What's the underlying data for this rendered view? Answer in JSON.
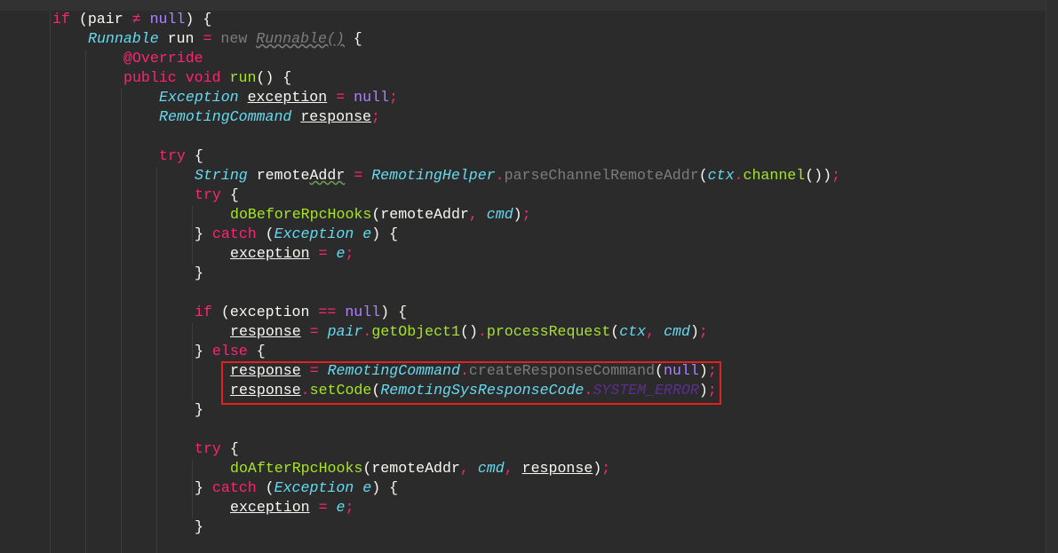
{
  "editor": {
    "language": "Java",
    "theme_colors": {
      "background": "#2b2b2b",
      "keyword": "#f92672",
      "type": "#66d9ef",
      "function": "#a6e22e",
      "null_literal": "#ae81ff",
      "plain": "#f8f8f2",
      "dim": "#7c7c7c",
      "constant": "#5e2d91",
      "highlight_box": "#e2201d"
    },
    "lines": [
      {
        "tokens": [
          {
            "t": "if",
            "c": "kw"
          },
          {
            "t": " (",
            "c": "plain"
          },
          {
            "t": "pair",
            "c": "var"
          },
          {
            "t": " ≠ ",
            "c": "op"
          },
          {
            "t": "null",
            "c": "null"
          },
          {
            "t": ") {",
            "c": "plain"
          }
        ]
      },
      {
        "tokens": [
          {
            "t": "Runnable",
            "c": "type"
          },
          {
            "t": " run ",
            "c": "var"
          },
          {
            "t": "=",
            "c": "op"
          },
          {
            "t": " ",
            "c": "plain"
          },
          {
            "t": "new",
            "c": "new"
          },
          {
            "t": " ",
            "c": "plain"
          },
          {
            "t": "Runnable()",
            "c": "anon"
          },
          {
            "t": " {",
            "c": "plain"
          }
        ]
      },
      {
        "tokens": [
          {
            "t": "@Override",
            "c": "ann"
          }
        ]
      },
      {
        "tokens": [
          {
            "t": "public",
            "c": "kw"
          },
          {
            "t": " ",
            "c": "plain"
          },
          {
            "t": "void",
            "c": "kw"
          },
          {
            "t": " ",
            "c": "plain"
          },
          {
            "t": "run",
            "c": "fn"
          },
          {
            "t": "() {",
            "c": "plain"
          }
        ]
      },
      {
        "tokens": [
          {
            "t": "Exception",
            "c": "type"
          },
          {
            "t": " ",
            "c": "plain"
          },
          {
            "t": "exception",
            "c": "uvar"
          },
          {
            "t": " ",
            "c": "plain"
          },
          {
            "t": "=",
            "c": "op"
          },
          {
            "t": " ",
            "c": "plain"
          },
          {
            "t": "null",
            "c": "null"
          },
          {
            "t": ";",
            "c": "punct"
          }
        ]
      },
      {
        "tokens": [
          {
            "t": "RemotingCommand",
            "c": "type"
          },
          {
            "t": " ",
            "c": "plain"
          },
          {
            "t": "response",
            "c": "uvar"
          },
          {
            "t": ";",
            "c": "punct"
          }
        ]
      },
      {
        "tokens": []
      },
      {
        "tokens": [
          {
            "t": "try",
            "c": "kw"
          },
          {
            "t": " {",
            "c": "plain"
          }
        ]
      },
      {
        "tokens": [
          {
            "t": "String",
            "c": "type"
          },
          {
            "t": " remote",
            "c": "var"
          },
          {
            "t": "Addr",
            "c": "squig"
          },
          {
            "t": " ",
            "c": "plain"
          },
          {
            "t": "=",
            "c": "op"
          },
          {
            "t": " ",
            "c": "plain"
          },
          {
            "t": "RemotingHelper",
            "c": "type"
          },
          {
            "t": ".",
            "c": "punct"
          },
          {
            "t": "parseChannelRemoteAddr",
            "c": "fndim"
          },
          {
            "t": "(",
            "c": "plain"
          },
          {
            "t": "ctx",
            "c": "param"
          },
          {
            "t": ".",
            "c": "punct"
          },
          {
            "t": "channel",
            "c": "fn"
          },
          {
            "t": "())",
            "c": "plain"
          },
          {
            "t": ";",
            "c": "punct"
          }
        ]
      },
      {
        "tokens": [
          {
            "t": "try",
            "c": "kw"
          },
          {
            "t": " {",
            "c": "plain"
          }
        ]
      },
      {
        "tokens": [
          {
            "t": "doBeforeRpcHooks",
            "c": "fn"
          },
          {
            "t": "(remoteAddr",
            "c": "plain"
          },
          {
            "t": ", ",
            "c": "punct"
          },
          {
            "t": "cmd",
            "c": "param"
          },
          {
            "t": ")",
            "c": "plain"
          },
          {
            "t": ";",
            "c": "punct"
          }
        ]
      },
      {
        "tokens": [
          {
            "t": "} ",
            "c": "plain"
          },
          {
            "t": "catch",
            "c": "kw"
          },
          {
            "t": " (",
            "c": "plain"
          },
          {
            "t": "Exception",
            "c": "type"
          },
          {
            "t": " ",
            "c": "plain"
          },
          {
            "t": "e",
            "c": "param"
          },
          {
            "t": ") {",
            "c": "plain"
          }
        ]
      },
      {
        "tokens": [
          {
            "t": "exception",
            "c": "uvar"
          },
          {
            "t": " ",
            "c": "plain"
          },
          {
            "t": "=",
            "c": "op"
          },
          {
            "t": " ",
            "c": "plain"
          },
          {
            "t": "e",
            "c": "param"
          },
          {
            "t": ";",
            "c": "punct"
          }
        ]
      },
      {
        "tokens": [
          {
            "t": "}",
            "c": "plain"
          }
        ]
      },
      {
        "tokens": []
      },
      {
        "tokens": [
          {
            "t": "if",
            "c": "kw"
          },
          {
            "t": " (",
            "c": "plain"
          },
          {
            "t": "exception",
            "c": "var"
          },
          {
            "t": " == ",
            "c": "op"
          },
          {
            "t": "null",
            "c": "null"
          },
          {
            "t": ") {",
            "c": "plain"
          }
        ]
      },
      {
        "tokens": [
          {
            "t": "response",
            "c": "uvar"
          },
          {
            "t": " ",
            "c": "plain"
          },
          {
            "t": "=",
            "c": "op"
          },
          {
            "t": " ",
            "c": "plain"
          },
          {
            "t": "pair",
            "c": "param"
          },
          {
            "t": ".",
            "c": "punct"
          },
          {
            "t": "getObject1",
            "c": "fn"
          },
          {
            "t": "()",
            "c": "plain"
          },
          {
            "t": ".",
            "c": "punct"
          },
          {
            "t": "processRequest",
            "c": "fn"
          },
          {
            "t": "(",
            "c": "plain"
          },
          {
            "t": "ctx",
            "c": "param"
          },
          {
            "t": ", ",
            "c": "punct"
          },
          {
            "t": "cmd",
            "c": "param"
          },
          {
            "t": ")",
            "c": "plain"
          },
          {
            "t": ";",
            "c": "punct"
          }
        ]
      },
      {
        "tokens": [
          {
            "t": "} ",
            "c": "plain"
          },
          {
            "t": "else",
            "c": "kw"
          },
          {
            "t": " {",
            "c": "plain"
          }
        ]
      },
      {
        "tokens": [
          {
            "t": "response",
            "c": "uvar"
          },
          {
            "t": " ",
            "c": "plain"
          },
          {
            "t": "=",
            "c": "op"
          },
          {
            "t": " ",
            "c": "plain"
          },
          {
            "t": "RemotingCommand",
            "c": "type"
          },
          {
            "t": ".",
            "c": "punct"
          },
          {
            "t": "createResponseCommand",
            "c": "fndim"
          },
          {
            "t": "(",
            "c": "plain"
          },
          {
            "t": "null",
            "c": "null"
          },
          {
            "t": ")",
            "c": "plain"
          },
          {
            "t": ";",
            "c": "punct"
          }
        ]
      },
      {
        "tokens": [
          {
            "t": "response",
            "c": "uvar"
          },
          {
            "t": ".",
            "c": "punct"
          },
          {
            "t": "setCode",
            "c": "fn"
          },
          {
            "t": "(",
            "c": "plain"
          },
          {
            "t": "RemotingSysResponseCode",
            "c": "type"
          },
          {
            "t": ".",
            "c": "punct"
          },
          {
            "t": "SYSTEM_ERROR",
            "c": "const"
          },
          {
            "t": ")",
            "c": "plain"
          },
          {
            "t": ";",
            "c": "punct"
          }
        ]
      },
      {
        "tokens": [
          {
            "t": "}",
            "c": "plain"
          }
        ]
      },
      {
        "tokens": []
      },
      {
        "tokens": [
          {
            "t": "try",
            "c": "kw"
          },
          {
            "t": " {",
            "c": "plain"
          }
        ]
      },
      {
        "tokens": [
          {
            "t": "doAfterRpcHooks",
            "c": "fn"
          },
          {
            "t": "(remoteAddr",
            "c": "plain"
          },
          {
            "t": ", ",
            "c": "punct"
          },
          {
            "t": "cmd",
            "c": "param"
          },
          {
            "t": ", ",
            "c": "punct"
          },
          {
            "t": "response",
            "c": "uvar"
          },
          {
            "t": ")",
            "c": "plain"
          },
          {
            "t": ";",
            "c": "punct"
          }
        ]
      },
      {
        "tokens": [
          {
            "t": "} ",
            "c": "plain"
          },
          {
            "t": "catch",
            "c": "kw"
          },
          {
            "t": " (",
            "c": "plain"
          },
          {
            "t": "Exception",
            "c": "type"
          },
          {
            "t": " ",
            "c": "plain"
          },
          {
            "t": "e",
            "c": "param"
          },
          {
            "t": ") {",
            "c": "plain"
          }
        ]
      },
      {
        "tokens": [
          {
            "t": "exception",
            "c": "uvar"
          },
          {
            "t": " ",
            "c": "plain"
          },
          {
            "t": "=",
            "c": "op"
          },
          {
            "t": " ",
            "c": "plain"
          },
          {
            "t": "e",
            "c": "param"
          },
          {
            "t": ";",
            "c": "punct"
          }
        ]
      },
      {
        "tokens": [
          {
            "t": "}",
            "c": "plain"
          }
        ]
      }
    ]
  }
}
